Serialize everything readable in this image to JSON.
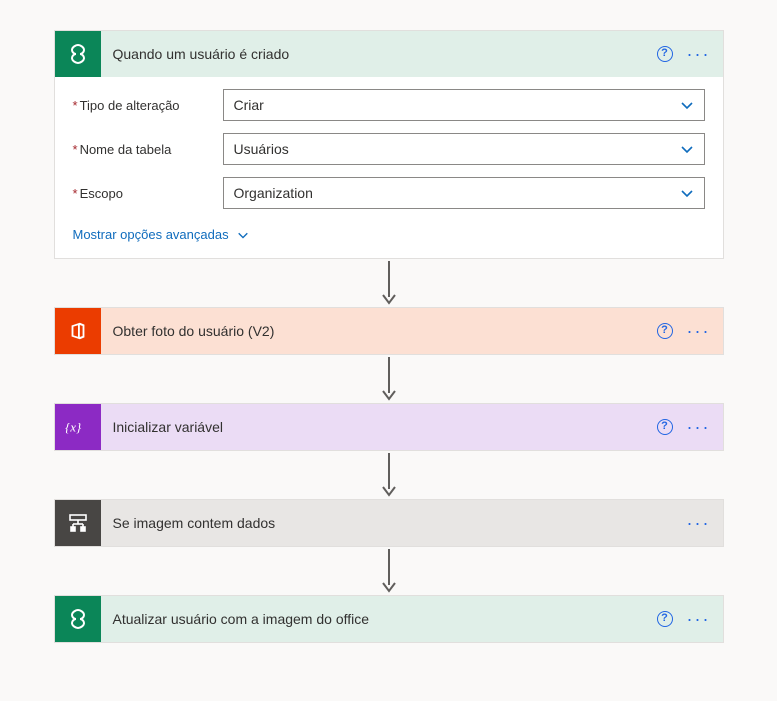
{
  "steps": {
    "trigger": {
      "title": "Quando um usuário é criado",
      "params": {
        "change_type": {
          "label": "Tipo de alteração",
          "value": "Criar"
        },
        "table_name": {
          "label": "Nome da tabela",
          "value": "Usuários"
        },
        "scope": {
          "label": "Escopo",
          "value": "Organization"
        }
      },
      "advanced_label": "Mostrar opções avançadas"
    },
    "get_photo": {
      "title": "Obter foto do usuário (V2)"
    },
    "init_var": {
      "title": "Inicializar variável"
    },
    "if_image": {
      "title": "Se imagem contem dados"
    },
    "update_user": {
      "title": "Atualizar usuário com a imagem do office"
    }
  }
}
